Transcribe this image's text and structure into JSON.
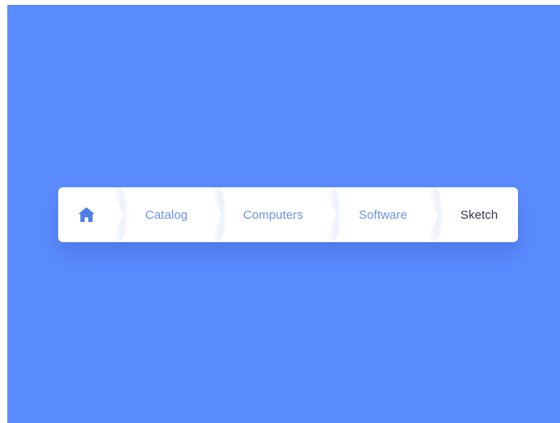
{
  "page": {
    "background_color": "#5b8cff"
  },
  "breadcrumb": {
    "home_icon": "home-icon",
    "accent_color": "#4e7fe6",
    "items": [
      {
        "label": "Catalog",
        "state": "link"
      },
      {
        "label": "Computers",
        "state": "link"
      },
      {
        "label": "Software",
        "state": "link"
      },
      {
        "label": "Sketch",
        "state": "current"
      }
    ]
  }
}
